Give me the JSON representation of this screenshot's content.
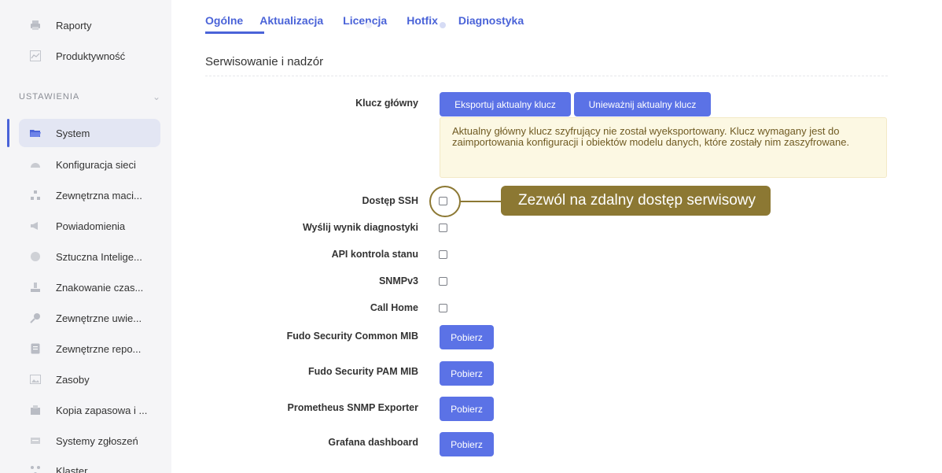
{
  "sidebar": {
    "items_top": [
      {
        "label": "Raporty",
        "icon": "printer-icon"
      },
      {
        "label": "Produktywność",
        "icon": "chart-icon"
      }
    ],
    "section_label": "USTAWIENIA",
    "section_chevron": "chevron-down-icon",
    "items": [
      {
        "label": "System",
        "icon": "folder-icon",
        "active": true
      },
      {
        "label": "Konfiguracja sieci",
        "icon": "network-icon"
      },
      {
        "label": "Zewnętrzna maci...",
        "icon": "hierarchy-icon"
      },
      {
        "label": "Powiadomienia",
        "icon": "megaphone-icon"
      },
      {
        "label": "Sztuczna Intelige...",
        "icon": "brain-icon"
      },
      {
        "label": "Znakowanie czas...",
        "icon": "stamp-icon"
      },
      {
        "label": "Zewnętrzne uwie...",
        "icon": "key-icon"
      },
      {
        "label": "Zewnętrzne repo...",
        "icon": "database-icon"
      },
      {
        "label": "Zasoby",
        "icon": "image-icon"
      },
      {
        "label": "Kopia zapasowa i ...",
        "icon": "backup-icon"
      },
      {
        "label": "Systemy zgłoszeń",
        "icon": "ticket-icon"
      },
      {
        "label": "Klaster",
        "icon": "cluster-icon"
      }
    ]
  },
  "tabs": [
    {
      "label": "Ogólne",
      "active": true
    },
    {
      "label": "Aktualizacja"
    },
    {
      "label": "Licencja"
    },
    {
      "label": "Hotfix"
    },
    {
      "label": "Diagnostyka"
    }
  ],
  "section_title": "Serwisowanie i nadzór",
  "master_key": {
    "label": "Klucz główny",
    "export_button": "Eksportuj aktualny klucz",
    "invalidate_button": "Unieważnij aktualny klucz",
    "warning": "Aktualny główny klucz szyfrujący nie został wyeksportowany. Klucz wymagany jest do zaimportowania konfiguracji i obiektów modelu danych, które zostały nim zaszyfrowane."
  },
  "checkbox_rows": [
    {
      "label": "Dostęp SSH",
      "checked": false
    },
    {
      "label": "Wyślij wynik diagnostyki",
      "checked": false
    },
    {
      "label": "API kontrola stanu",
      "checked": false
    },
    {
      "label": "SNMPv3",
      "checked": false
    },
    {
      "label": "Call Home",
      "checked": false
    }
  ],
  "download_rows": [
    {
      "label": "Fudo Security Common MIB",
      "button": "Pobierz"
    },
    {
      "label": "Fudo Security PAM MIB",
      "button": "Pobierz"
    },
    {
      "label": "Prometheus SNMP Exporter",
      "button": "Pobierz"
    },
    {
      "label": "Grafana dashboard",
      "button": "Pobierz"
    }
  ],
  "callout": {
    "text": "Zezwól na zdalny dostęp serwisowy"
  },
  "colors": {
    "accent": "#4a63d8",
    "button": "#5b72e6",
    "callout": "#8c7833",
    "warning_bg": "#fcf8e3"
  }
}
